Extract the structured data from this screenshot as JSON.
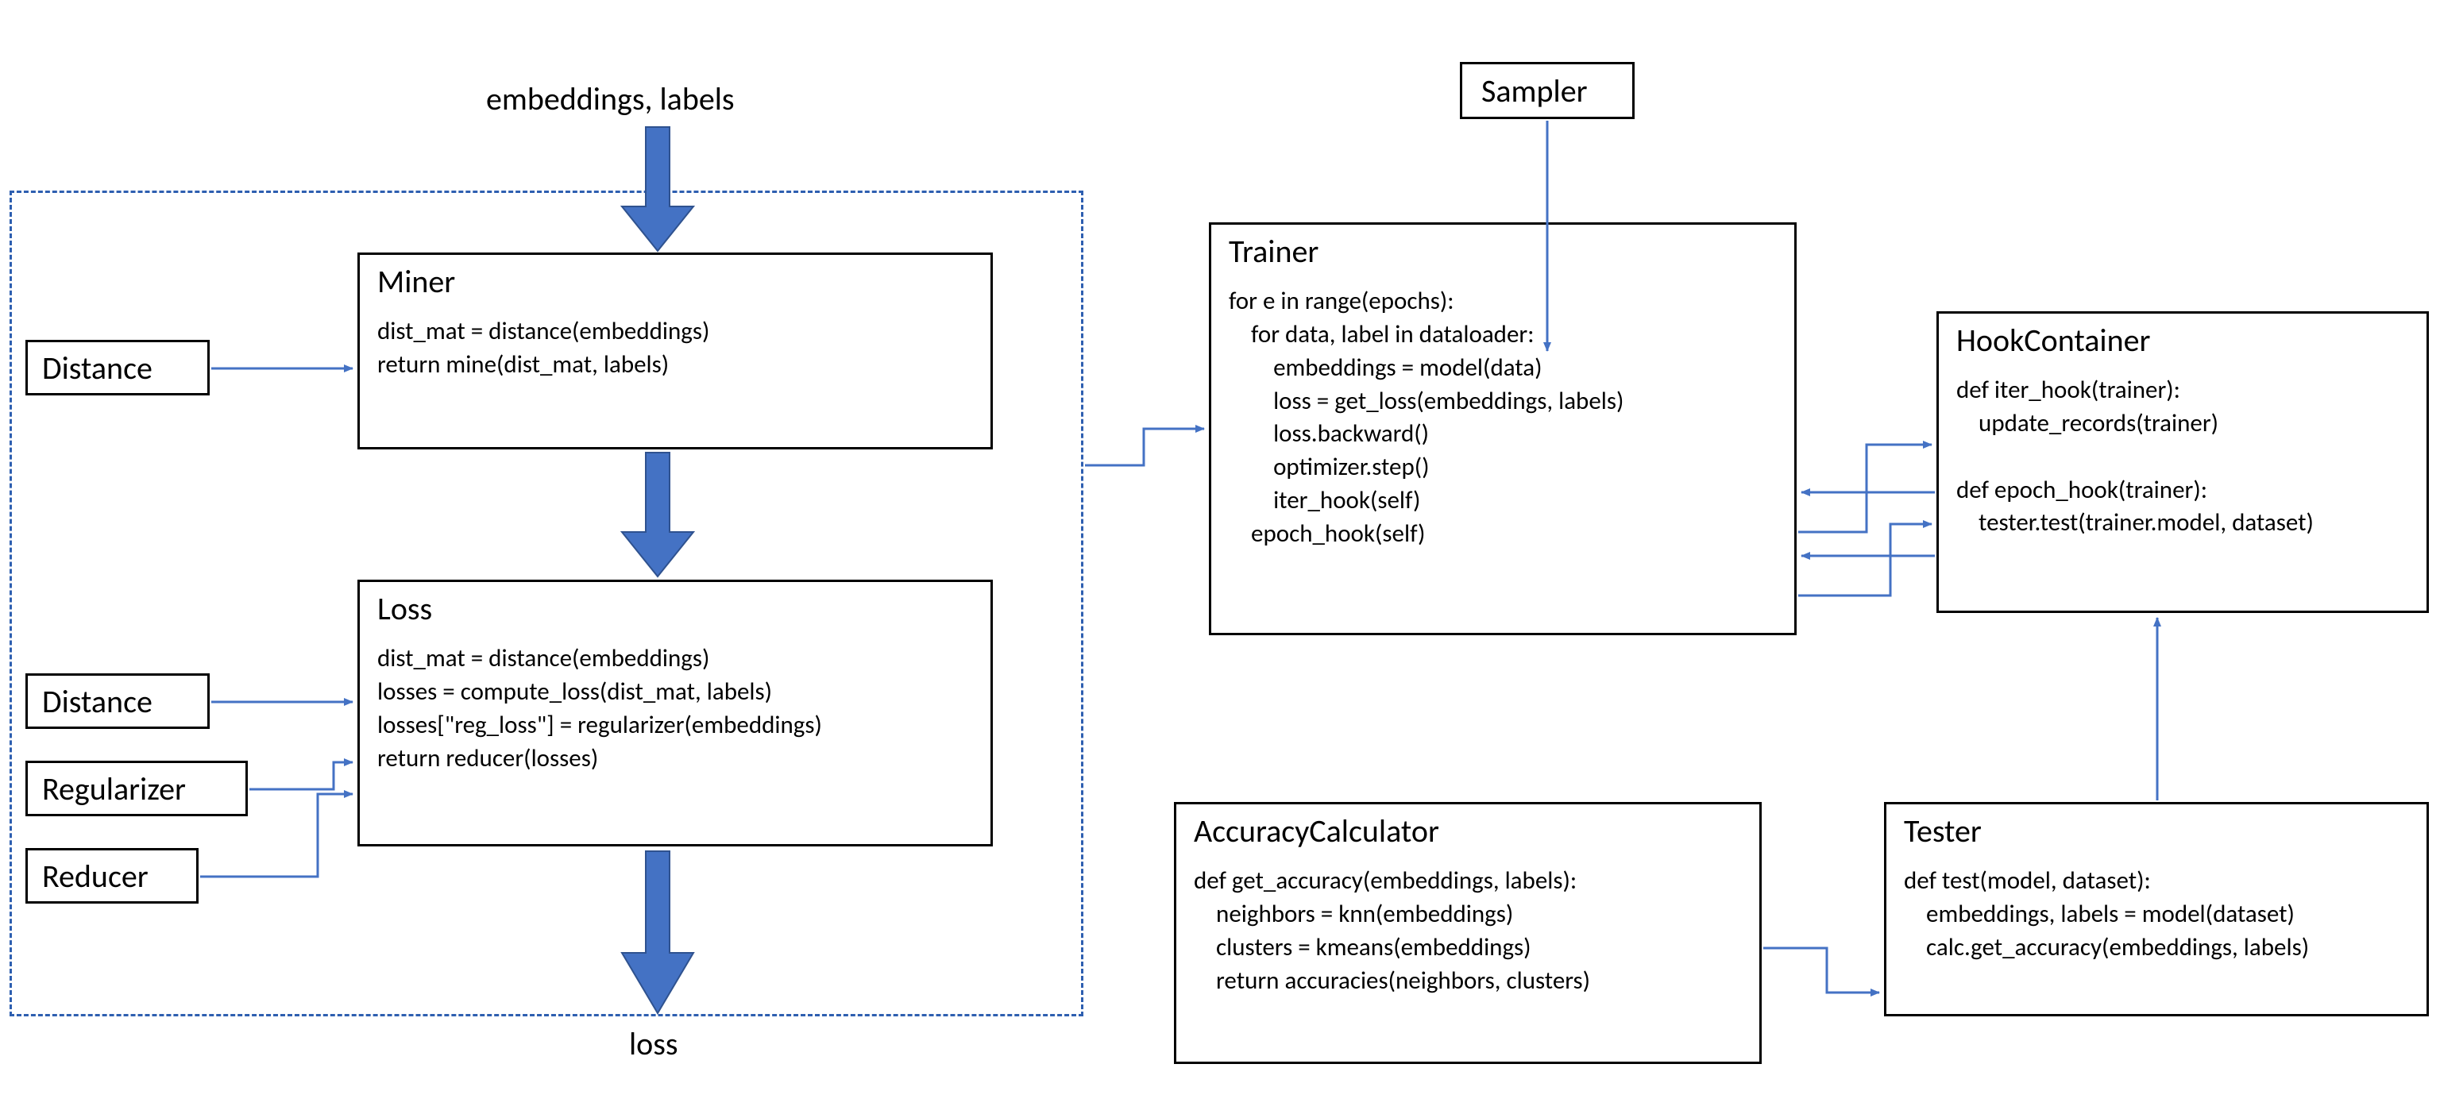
{
  "labels": {
    "top_input": "embeddings, labels",
    "bottom_output": "loss"
  },
  "small_boxes": {
    "distance_miner": "Distance",
    "distance_loss": "Distance",
    "regularizer": "Regularizer",
    "reducer": "Reducer",
    "sampler": "Sampler"
  },
  "boxes": {
    "miner": {
      "title": "Miner",
      "body": "dist_mat = distance(embeddings)\nreturn mine(dist_mat, labels)"
    },
    "loss": {
      "title": "Loss",
      "body": "dist_mat = distance(embeddings)\nlosses = compute_loss(dist_mat, labels)\nlosses[\"reg_loss\"] = regularizer(embeddings)\nreturn reducer(losses)"
    },
    "trainer": {
      "title": "Trainer",
      "body": "for e in range(epochs):\n    for data, label in dataloader:\n        embeddings = model(data)\n        loss = get_loss(embeddings, labels)\n        loss.backward()\n        optimizer.step()\n        iter_hook(self)\n    epoch_hook(self)"
    },
    "hook": {
      "title": "HookContainer",
      "body": "def iter_hook(trainer):\n    update_records(trainer)\n\ndef epoch_hook(trainer):\n    tester.test(trainer.model, dataset)"
    },
    "accuracy": {
      "title": "AccuracyCalculator",
      "body": "def get_accuracy(embeddings, labels):\n    neighbors = knn(embeddings)\n    clusters = kmeans(embeddings)\n    return accuracies(neighbors, clusters)"
    },
    "tester": {
      "title": "Tester",
      "body": "def test(model, dataset):\n    embeddings, labels = model(dataset)\n    calc.get_accuracy(embeddings, labels)"
    }
  },
  "colors": {
    "thick_arrow": "#4472c4",
    "thin_arrow": "#4472c4",
    "dashed_border": "#2e5fb0"
  }
}
